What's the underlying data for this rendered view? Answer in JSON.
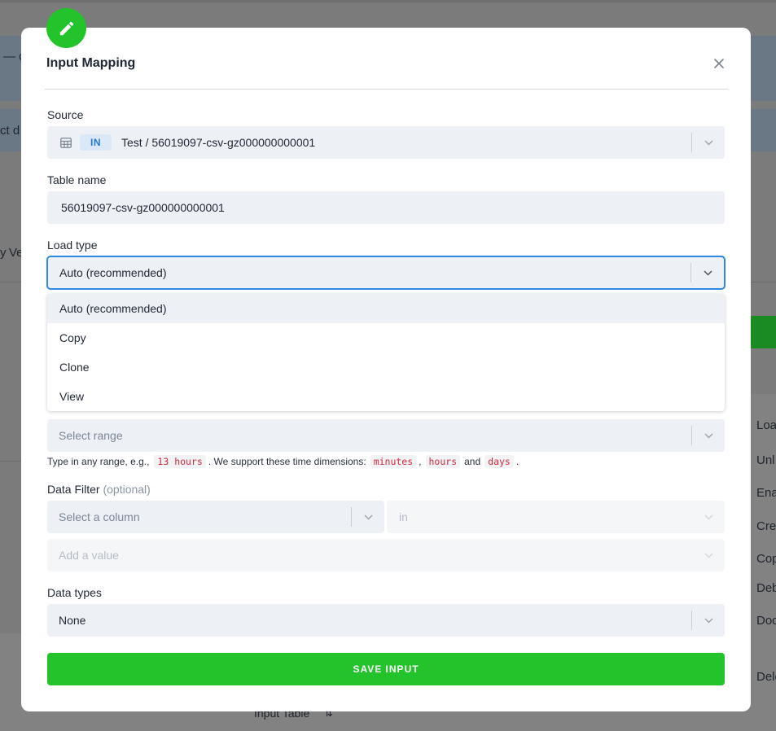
{
  "background": {
    "fragment_1": "— c",
    "fragment_2": "ct d",
    "fragment_3": "Ve",
    "fragment_4": "y",
    "footer_label": "Input Table",
    "right_items": [
      "Loa",
      "Unl",
      "Ena",
      "Cre",
      "Cop",
      "Deb",
      "Doc",
      "Dele"
    ]
  },
  "modal": {
    "title": "Input Mapping",
    "source": {
      "label": "Source",
      "tag": "IN",
      "value": "Test / 56019097-csv-gz000000000001"
    },
    "table_name": {
      "label": "Table name",
      "value": "56019097-csv-gz000000000001"
    },
    "load_type": {
      "label": "Load type",
      "value": "Auto (recommended)",
      "options": [
        "Auto (recommended)",
        "Copy",
        "Clone",
        "View"
      ]
    },
    "changed_in_last": {
      "placeholder": "Select range",
      "hint_parts": {
        "text1": "Type in any range, e.g.,",
        "example": "13 hours",
        "text2": ". We support these time dimensions:",
        "dim1": "minutes",
        "dim2": "hours",
        "and": "and",
        "dim3": "days",
        "end": "."
      }
    },
    "data_filter": {
      "label": "Data Filter",
      "optional": "(optional)",
      "column_placeholder": "Select a column",
      "operator": "in",
      "value_placeholder": "Add a value"
    },
    "data_types": {
      "label": "Data types",
      "value": "None"
    },
    "save_label": "SAVE INPUT"
  },
  "colors": {
    "accent_green": "#22c32b",
    "focus_blue": "#2d8ae0",
    "tag_blue": "#2479d4",
    "code_red": "#d52b3d"
  }
}
